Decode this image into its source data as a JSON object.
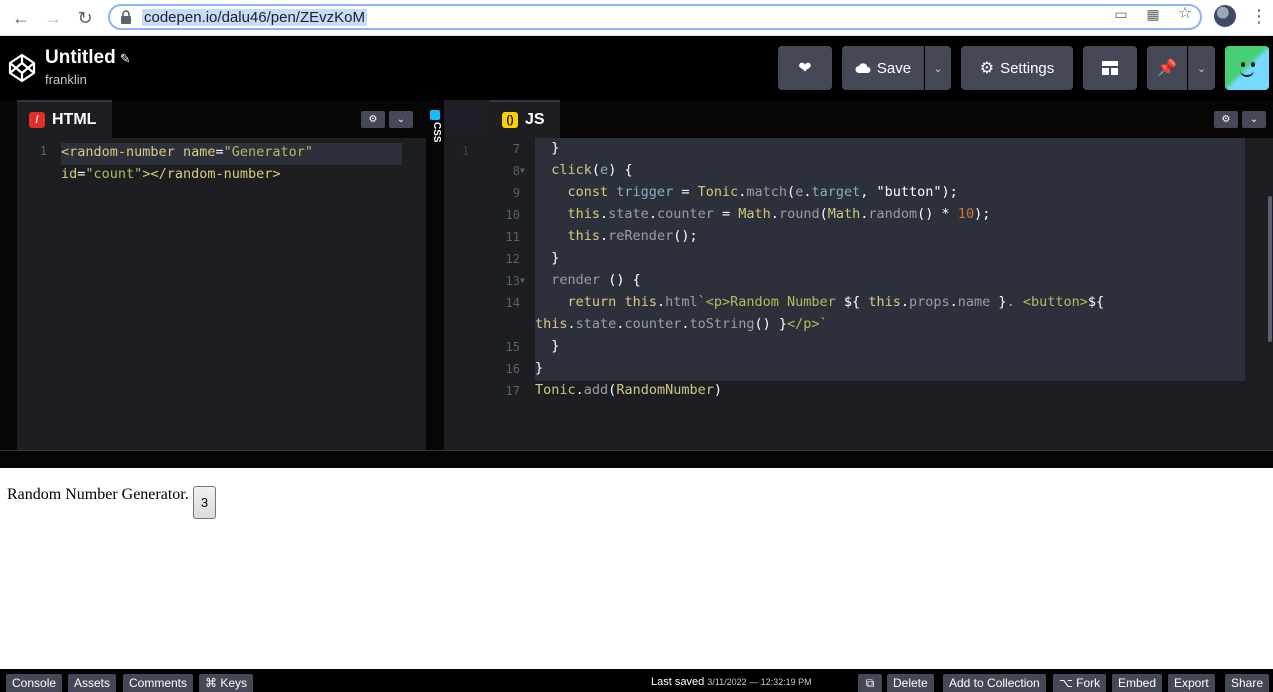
{
  "browser": {
    "url": "codepen.io/dalu46/pen/ZEvzKoM",
    "icons": [
      "back-icon",
      "forward-icon",
      "reload-icon",
      "lock-icon",
      "cast-icon",
      "qr-icon",
      "star-icon",
      "avatar",
      "more-icon"
    ]
  },
  "header": {
    "title": "Untitled",
    "user": "franklin",
    "save_label": "Save",
    "settings_label": "Settings"
  },
  "editors": {
    "html": {
      "tab_label": "HTML",
      "line_numbers": [
        "1"
      ]
    },
    "css": {
      "tab_label": "CSS",
      "line_numbers": [
        "1"
      ]
    },
    "js": {
      "tab_label": "JS",
      "line_numbers": [
        "7",
        "8",
        "9",
        "10",
        "11",
        "12",
        "13",
        "14",
        "15",
        "16",
        "17"
      ]
    }
  },
  "preview": {
    "text": "Random Number Generator.",
    "button_value": "3"
  },
  "footer": {
    "console": "Console",
    "assets": "Assets",
    "comments": "Comments",
    "keys": "⌘ Keys",
    "last_saved_label": "Last saved",
    "last_saved_time": "3/11/2022 — 12:32:19 PM",
    "delete": "Delete",
    "add_to_collection": "Add to Collection",
    "fork": "Fork",
    "embed": "Embed",
    "export": "Export",
    "share": "Share"
  },
  "colors": {
    "header_bg": "#000000",
    "button_bg": "#444857",
    "editor_bg": "#1d1e22",
    "html_badge": "#e42c2c",
    "css_badge": "#0ebeff",
    "js_badge": "#fcd000"
  }
}
